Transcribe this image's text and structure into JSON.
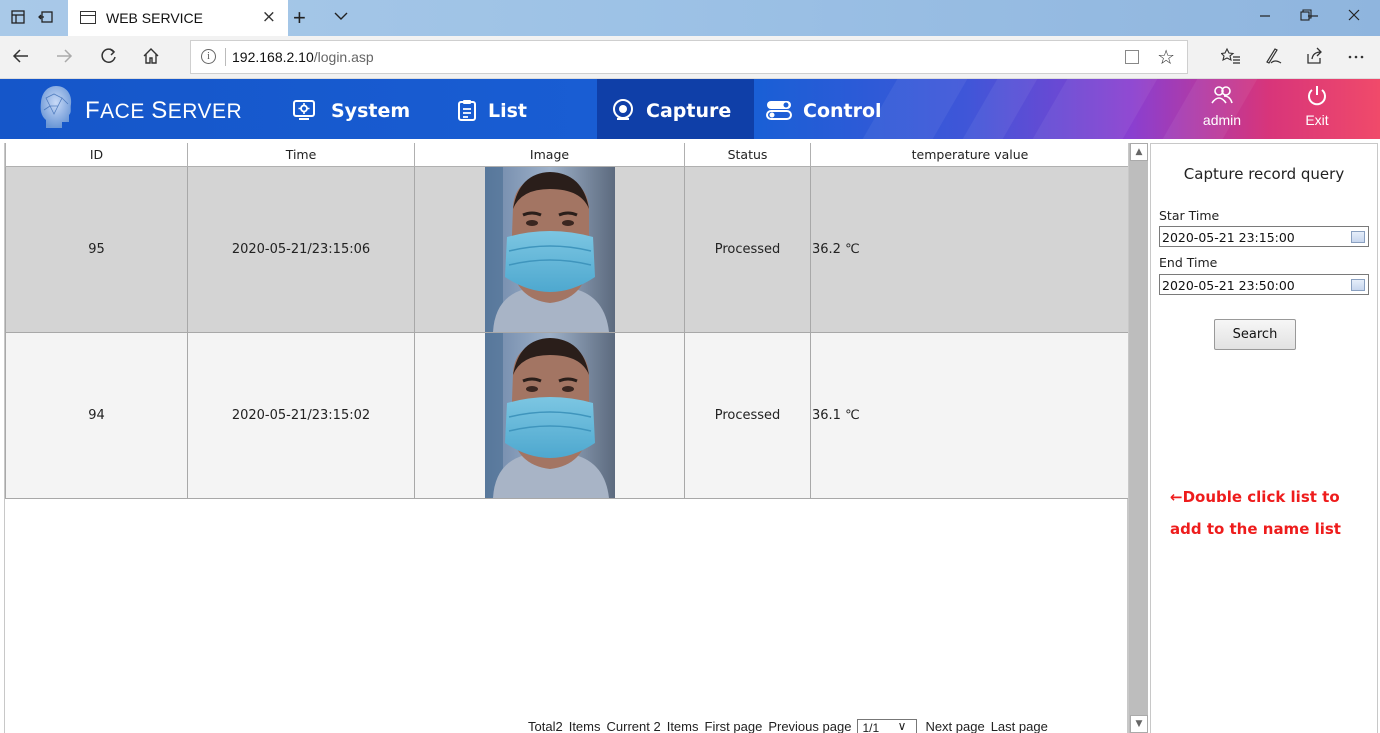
{
  "browser": {
    "tab_title": "WEB SERVICE",
    "tab_close": "×",
    "new_tab": "+",
    "url_host": "192.168.2.10",
    "url_path": "/login.asp",
    "icons": [
      "tab-preview-icon",
      "set-aside-tabs-icon",
      "page-icon",
      "back-icon",
      "forward-icon",
      "refresh-icon",
      "home-icon",
      "info-icon",
      "reading-view-icon",
      "favorite-star-icon",
      "favorites-list-icon",
      "pen-icon",
      "share-icon",
      "more-icon"
    ]
  },
  "header": {
    "brand_initial_1": "F",
    "brand_rest_1": "ACE ",
    "brand_initial_2": "S",
    "brand_rest_2": "ERVER",
    "menu": [
      {
        "label": "System",
        "icon": "system-monitor-icon"
      },
      {
        "label": "List",
        "icon": "clipboard-list-icon"
      },
      {
        "label": "Capture",
        "icon": "capture-camera-icon",
        "active": true
      },
      {
        "label": "Control",
        "icon": "control-toggle-icon"
      }
    ],
    "user_label": "admin",
    "exit_label": "Exit",
    "colors": {
      "primary": "#1a5fd6",
      "active": "#0f3fa8",
      "accent": "#f04a6a"
    }
  },
  "table": {
    "columns": [
      "ID",
      "Time",
      "Image",
      "Status",
      "temperature value"
    ],
    "rows": [
      {
        "id": "95",
        "time": "2020-05-21/23:15:06",
        "status": "Processed",
        "temperature": "36.2 ℃"
      },
      {
        "id": "94",
        "time": "2020-05-21/23:15:02",
        "status": "Processed",
        "temperature": "36.1 ℃"
      }
    ]
  },
  "pager": {
    "total": "Total2",
    "items_1": "Items",
    "current": "Current 2",
    "items_2": "Items",
    "first": "First page",
    "previous": "Previous page",
    "page_value": "1/1",
    "next": "Next page",
    "last": "Last page"
  },
  "panel": {
    "title": "Capture record query",
    "start_label": "Star Time",
    "start_value": "2020-05-21 23:15:00",
    "end_label": "End Time",
    "end_value": "2020-05-21 23:50:00",
    "search_label": "Search",
    "hint_line1": "←Double click list to",
    "hint_line2": "add to the name list",
    "hint_color": "#ee1c1c"
  }
}
